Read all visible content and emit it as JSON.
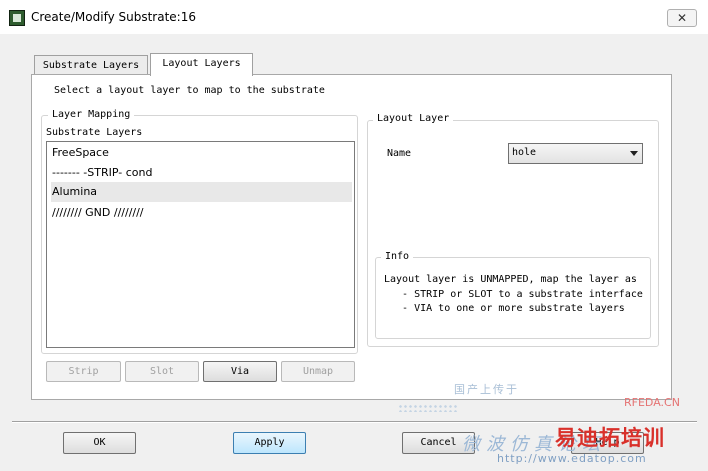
{
  "window": {
    "title": "Create/Modify Substrate:16",
    "close_glyph": "✕"
  },
  "tabs": [
    {
      "label": "Substrate Layers",
      "active": false
    },
    {
      "label": "Layout Layers",
      "active": true
    }
  ],
  "instruction": "Select a layout layer to map to the substrate",
  "layer_mapping": {
    "group_label": "Layer Mapping",
    "list_label": "Substrate Layers",
    "items": [
      "FreeSpace",
      "------- -STRIP- cond",
      "Alumina",
      "//////// GND ////////"
    ],
    "selected_index": 2,
    "buttons": {
      "strip": "Strip",
      "slot": "Slot",
      "via": "Via",
      "unmap": "Unmap"
    }
  },
  "layout_layer": {
    "group_label": "Layout Layer",
    "name_label": "Name",
    "name_value": "hole",
    "info": {
      "label": "Info",
      "lines": [
        "Layout layer is UNMAPPED, map the layer as",
        "   - STRIP or SLOT to a substrate interface",
        "   - VIA to one or more substrate layers"
      ]
    }
  },
  "footer": {
    "ok": "OK",
    "apply": "Apply",
    "cancel": "Cancel",
    "help": "Help"
  },
  "watermark": {
    "text1": "国产上传于",
    "brand": "RFEDA.CN",
    "cn_text": "微波仿真论坛",
    "logo": "易迪拓培训",
    "url": "http://www.edatop.com"
  },
  "colors": {
    "selection": "#e8e8e8",
    "default_button_border": "#3c7fb1",
    "logo_red": "#d9302a"
  }
}
